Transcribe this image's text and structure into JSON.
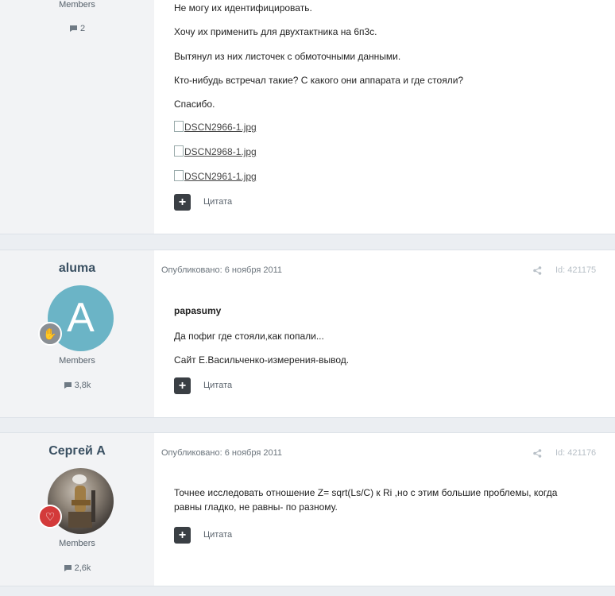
{
  "post0": {
    "group": "Members",
    "count": "2",
    "paragraphs": [
      "Не могу их идентифицировать.",
      "Хочу их применить для двухтактника на 6п3с.",
      "Вытянул из них листочек с обмоточными данными.",
      "Кто-нибудь встречал такие? С какого они аппарата и где стояли?",
      "Спасибо."
    ],
    "images": [
      "DSCN2966-1.jpg",
      "DSCN2968-1.jpg",
      "DSCN2961-1.jpg"
    ],
    "quote_label": "Цитата"
  },
  "post1": {
    "author": "aluma",
    "avatar_letter": "A",
    "group": "Members",
    "count": "3,8k",
    "meta": "Опубликовано: 6 ноября 2011",
    "post_id": "Id: 421175",
    "quoted_author": "papasumy",
    "paragraphs": [
      "Да пофиг где стояли,как попали...",
      "Сайт Е.Васильченко-измерения-вывод."
    ],
    "quote_label": "Цитата"
  },
  "post2": {
    "author": "Сергей А",
    "group": "Members",
    "count": "2,6k",
    "meta": "Опубликовано: 6 ноября 2011",
    "post_id": "Id: 421176",
    "paragraphs": [
      "Точнее исследовать отношение Z= sqrt(Ls/C) к Ri ,но с этим большие проблемы, когда",
      "равны гладко, не равны- по разному."
    ],
    "quote_label": "Цитата"
  },
  "colors": {
    "author_name": "#3a5062",
    "avatar_letter_bg": "#6bb4c6",
    "badge_gray": "#8a8f94",
    "badge_red": "#d33a3a"
  }
}
